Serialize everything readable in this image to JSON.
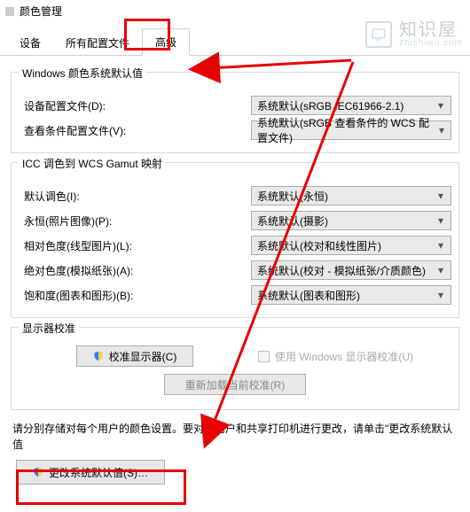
{
  "window_title": "颜色管理",
  "tabs": {
    "t1": "设备",
    "t2": "所有配置文件",
    "t3": "高级"
  },
  "watermark": {
    "zh": "知识屋",
    "en": "zhishiwu.com"
  },
  "group1": {
    "title": "Windows 颜色系统默认值",
    "row1_label": "设备配置文件(D):",
    "row1_value": "系统默认(sRGB IEC61966-2.1)",
    "row2_label": "查看条件配置文件(V):",
    "row2_value": "系统默认(sRGB 查看条件的 WCS 配置文件)"
  },
  "group2": {
    "title": "ICC 调色到 WCS Gamut 映射",
    "row1_label": "默认调色(I):",
    "row1_value": "系统默认(永恒)",
    "row2_label": "永恒(照片图像)(P):",
    "row2_value": "系统默认(摄影)",
    "row3_label": "相对色度(线型图片)(L):",
    "row3_value": "系统默认(校对和线性图片)",
    "row4_label": "绝对色度(模拟纸张)(A):",
    "row4_value": "系统默认(校对 - 模拟纸张/介质颜色)",
    "row5_label": "饱和度(图表和图形)(B):",
    "row5_value": "系统默认(图表和图形)"
  },
  "group3": {
    "title": "显示器校准",
    "btn_calibrate": "校准显示器(C)",
    "chk_label": "使用 Windows 显示器校准(U)",
    "btn_reload": "重新加载当前校准(R)"
  },
  "hint_text": "请分别存储对每个用户的颜色设置。要对新用户和共享打印机进行更改，请单击\"更改系统默认值",
  "btn_change": "更改系统默认值(S)…"
}
